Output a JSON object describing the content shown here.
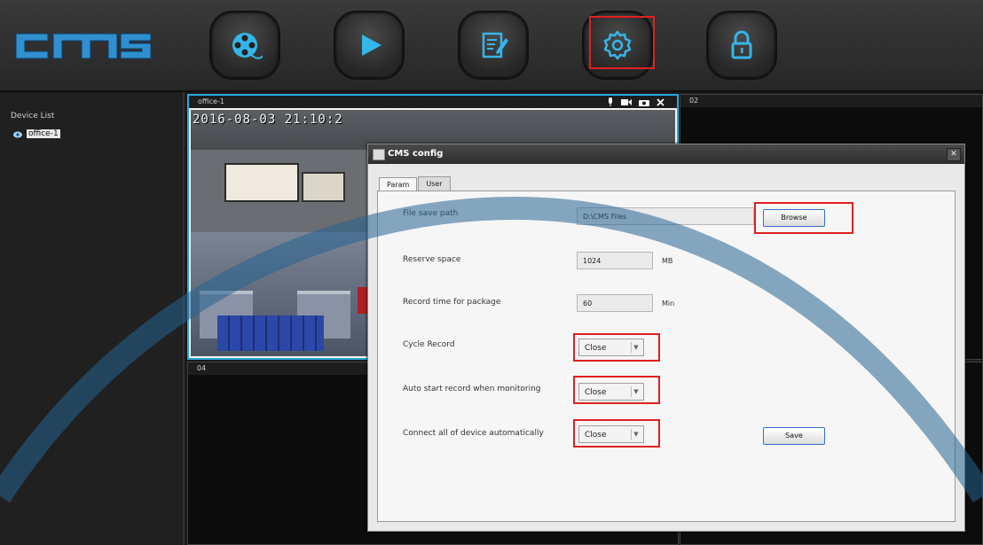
{
  "toolbar": {
    "logo_text": "CMS",
    "buttons": [
      "live-view",
      "playback",
      "log",
      "config",
      "lock"
    ],
    "active": "config"
  },
  "sidebar": {
    "title": "Device List",
    "device": "office-1"
  },
  "panes": {
    "p1": "office-1",
    "p1_osd": "2016-08-03  21:10:2",
    "p2": "02",
    "p4": "04"
  },
  "dialog": {
    "title": "CMS config",
    "tabs": [
      "Param",
      "User"
    ],
    "file_save_path_label": "File save path",
    "file_save_path_value": "D:\\CMS Files",
    "browse_label": "Browse",
    "reserve_space_label": "Reserve space",
    "reserve_space_value": "1024",
    "reserve_space_unit": "MB",
    "record_time_label": "Record time for package",
    "record_time_value": "60",
    "record_time_unit": "Min",
    "cycle_record_label": "Cycle Record",
    "cycle_record_value": "Close",
    "auto_start_label": "Auto start record when monitoring",
    "auto_start_value": "Close",
    "connect_all_label": "Connect all of device automatically",
    "connect_all_value": "Close",
    "save_label": "Save"
  },
  "colors": {
    "highlight": "#e02020",
    "selected_pane": "#2aa8e0",
    "arc": "#27638f"
  }
}
